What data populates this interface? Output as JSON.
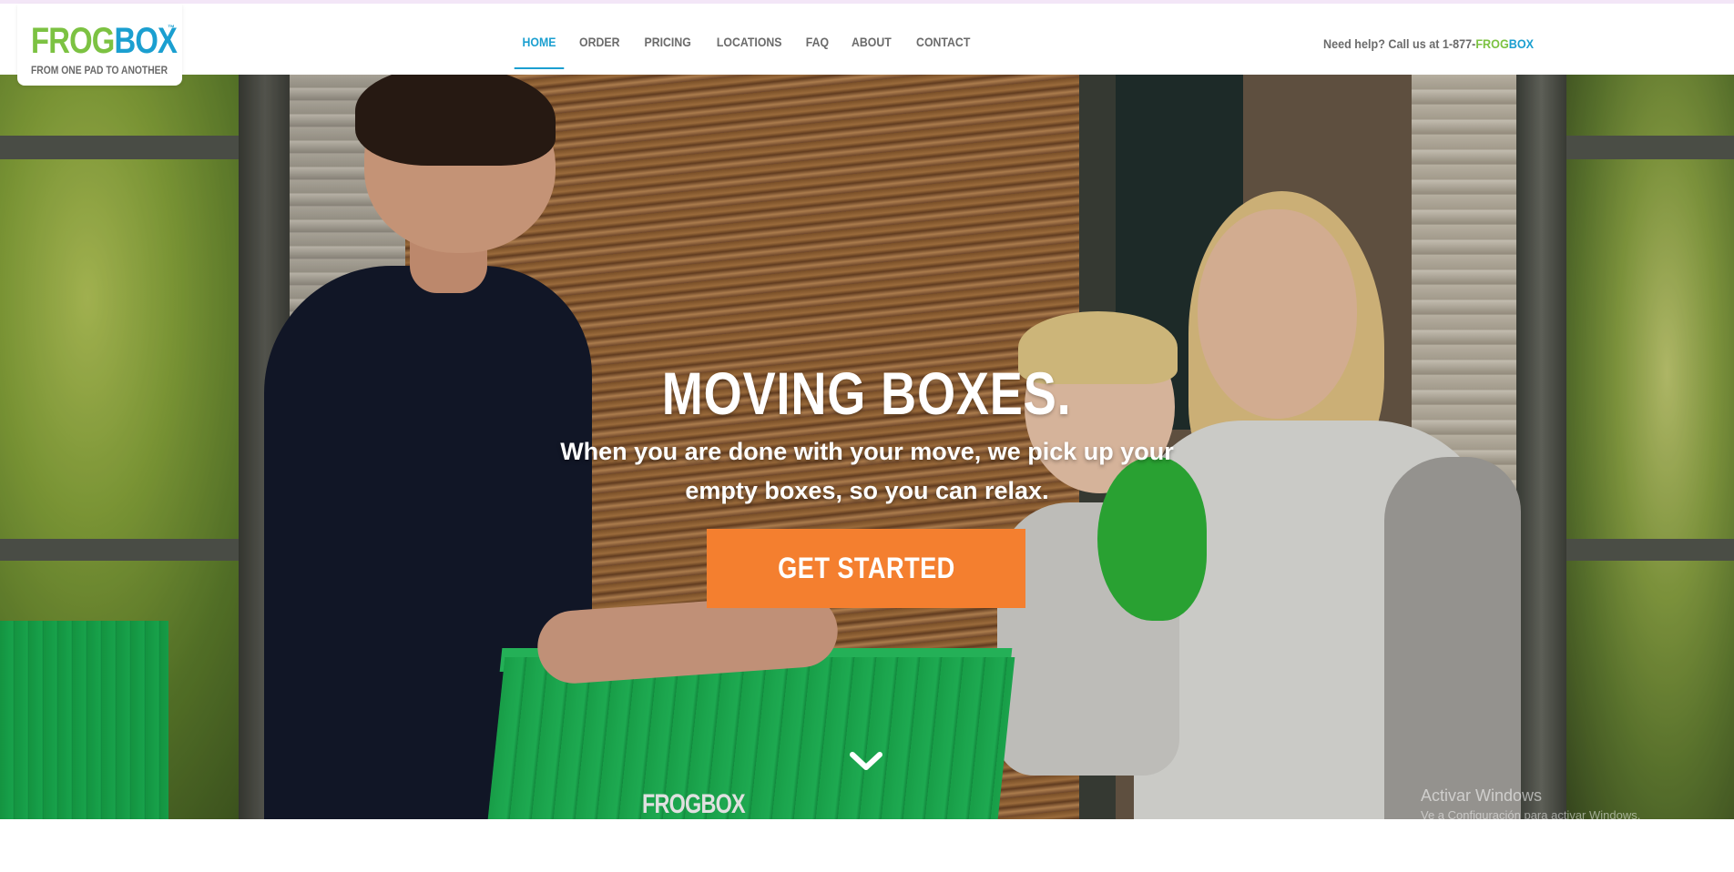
{
  "brand": {
    "logo_frog": "FROG",
    "logo_box": "BOX",
    "logo_tm": "™",
    "tagline": "FROM ONE PAD TO ANOTHER",
    "colors": {
      "green": "#7cc242",
      "blue": "#1b9fd0",
      "orange": "#f47f2f"
    }
  },
  "nav": {
    "items": [
      {
        "label": "HOME",
        "active": true
      },
      {
        "label": "ORDER",
        "active": false
      },
      {
        "label": "PRICING",
        "active": false
      },
      {
        "label": "LOCATIONS",
        "active": false
      },
      {
        "label": "FAQ",
        "active": false
      },
      {
        "label": "ABOUT",
        "active": false
      },
      {
        "label": "CONTACT",
        "active": false
      }
    ]
  },
  "help": {
    "prefix": "Need help? Call us at 1-877-",
    "frog": "FROG",
    "box": "BOX"
  },
  "hero": {
    "title": "MOVING BOXES.",
    "subtitle": "When you are done with your move, we pick up your empty boxes, so you can relax.",
    "cta_label": "GET STARTED",
    "crate_logo": "FROGBOX",
    "scroll_icon": "chevron-down-icon"
  },
  "system": {
    "watermark_title": "Activar Windows",
    "watermark_sub": "Ve a Configuración para activar Windows."
  }
}
